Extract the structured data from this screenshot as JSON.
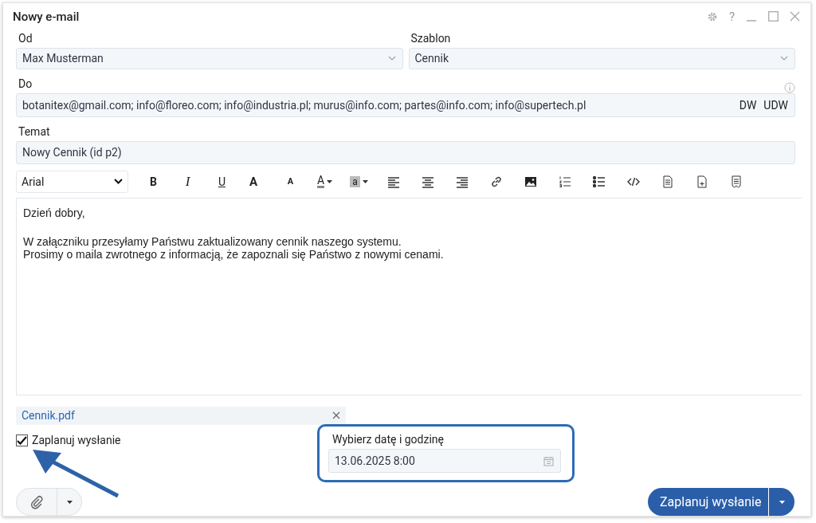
{
  "window": {
    "title": "Nowy e-mail",
    "help": "?"
  },
  "from": {
    "label": "Od",
    "value": "Max Musterman"
  },
  "template": {
    "label": "Szablon",
    "value": "Cennik"
  },
  "to": {
    "label": "Do",
    "value": "botanitex@gmail.com; info@floreo.com; info@industria.pl; murus@info.com; partes@info.com; info@supertech.pl",
    "cc": "DW",
    "bcc": "UDW"
  },
  "subject": {
    "label": "Temat",
    "value": "Nowy Cennik (id p2)"
  },
  "toolbar": {
    "font": "Arial",
    "buttons": [
      {
        "kind": "bold",
        "label": "B"
      },
      {
        "kind": "italic",
        "label": "I"
      },
      {
        "kind": "underline",
        "label": "U"
      },
      {
        "kind": "grow",
        "label": "A"
      },
      {
        "kind": "shrink",
        "label": "A"
      },
      {
        "kind": "color",
        "label": "A"
      },
      {
        "kind": "highlight",
        "label": "a"
      },
      {
        "kind": "align-left"
      },
      {
        "kind": "align-center"
      },
      {
        "kind": "align-right"
      },
      {
        "kind": "link"
      },
      {
        "kind": "image"
      },
      {
        "kind": "ordered-list"
      },
      {
        "kind": "bullet-list"
      },
      {
        "kind": "code"
      },
      {
        "kind": "document"
      },
      {
        "kind": "new-document"
      },
      {
        "kind": "template"
      }
    ]
  },
  "body": [
    {
      "lines": [
        "Dzień dobry,"
      ]
    },
    {
      "lines": [
        "W załączniku przesyłamy Państwu zaktualizowany cennik naszego systemu.",
        "Prosimy o maila zwrotnego z informacją, że zapoznali się Państwo z nowymi cenami."
      ]
    }
  ],
  "attachments": [
    {
      "name": "Cennik.pdf"
    }
  ],
  "schedule": {
    "label": "Zaplanuj wysłanie",
    "checked": true
  },
  "datetime": {
    "label": "Wybierz datę i godzinę",
    "value": "13.06.2025 8:00"
  },
  "send_button": {
    "label": "Zaplanuj wysłanie"
  }
}
